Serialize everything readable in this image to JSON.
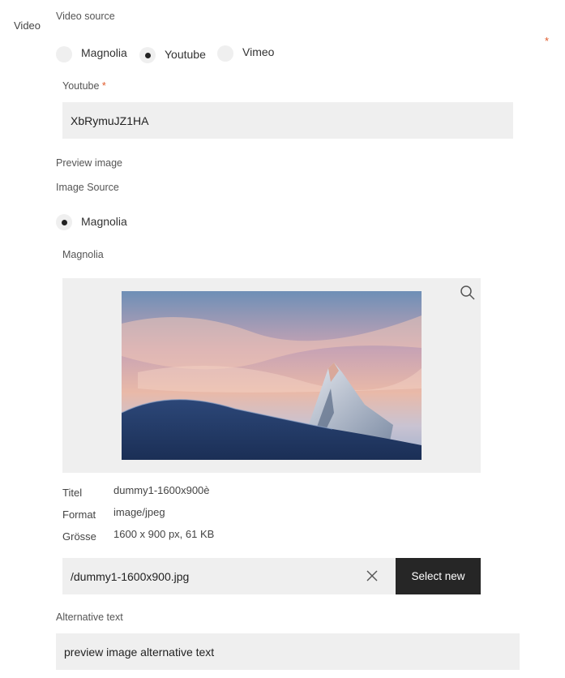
{
  "section": {
    "label": "Video"
  },
  "video_source": {
    "label": "Video source",
    "required_mark": "*",
    "options": [
      "Magnolia",
      "Youtube",
      "Vimeo"
    ],
    "selected": "Youtube"
  },
  "youtube": {
    "label": "Youtube",
    "required_mark": "*",
    "value": "XbRymuJZ1HA"
  },
  "preview_image": {
    "label": "Preview image",
    "image_source_label": "Image Source",
    "image_source_option": "Magnolia",
    "magnolia_label": "Magnolia"
  },
  "asset": {
    "meta": [
      {
        "key": "Titel",
        "value": "dummy1-1600x900è"
      },
      {
        "key": "Format",
        "value": "image/jpeg"
      },
      {
        "key": "Grösse",
        "value": "1600 x 900 px, 61 KB"
      }
    ],
    "path": "/dummy1-1600x900.jpg",
    "select_new_label": "Select new",
    "icons": {
      "zoom": "search-icon",
      "clear": "close-icon"
    }
  },
  "alt_text": {
    "label": "Alternative text",
    "value": "preview image alternative text"
  },
  "colors": {
    "required": "#e0592a",
    "button": "#262626",
    "field": "#efefef"
  }
}
